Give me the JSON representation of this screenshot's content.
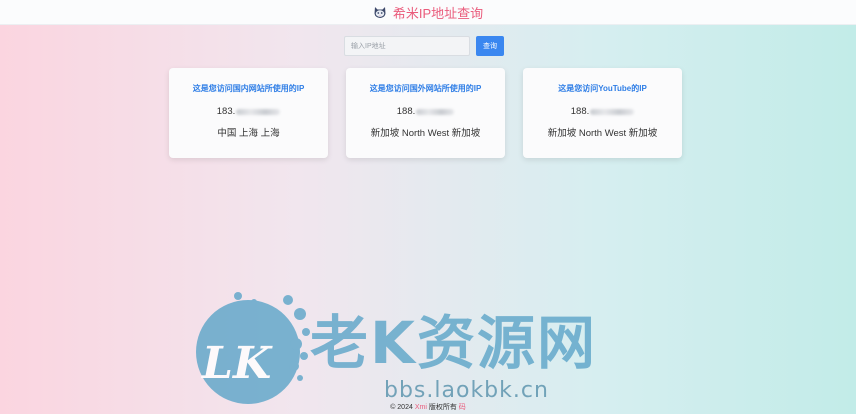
{
  "header": {
    "title": "希米IP地址查询",
    "logo_icon": "cat-logo-icon"
  },
  "search": {
    "placeholder": "输入IP地址",
    "value": "",
    "button_label": "查询"
  },
  "cards": [
    {
      "title": "这是您访问国内网站所使用的IP",
      "ip_visible": "183.",
      "location": "中国 上海 上海"
    },
    {
      "title": "这是您访问国外网站所使用的IP",
      "ip_visible": "188.",
      "location": "新加坡 North West 新加坡"
    },
    {
      "title": "这是您访问YouTube的IP",
      "ip_visible": "188.",
      "location": "新加坡 North West 新加坡"
    }
  ],
  "footer": {
    "copyright": "© 2024",
    "brand": "Xmi",
    "rights": "版权所有",
    "link": "码"
  },
  "watermark": {
    "logo_text": "LK",
    "brand_text": "老K资源网",
    "url": "bbs.laokbk.cn"
  },
  "colors": {
    "accent_pink": "#ea5c7c",
    "accent_blue": "#2f7ee6",
    "button_blue": "#3a87f0",
    "watermark_blue": "#5fa6c9"
  }
}
